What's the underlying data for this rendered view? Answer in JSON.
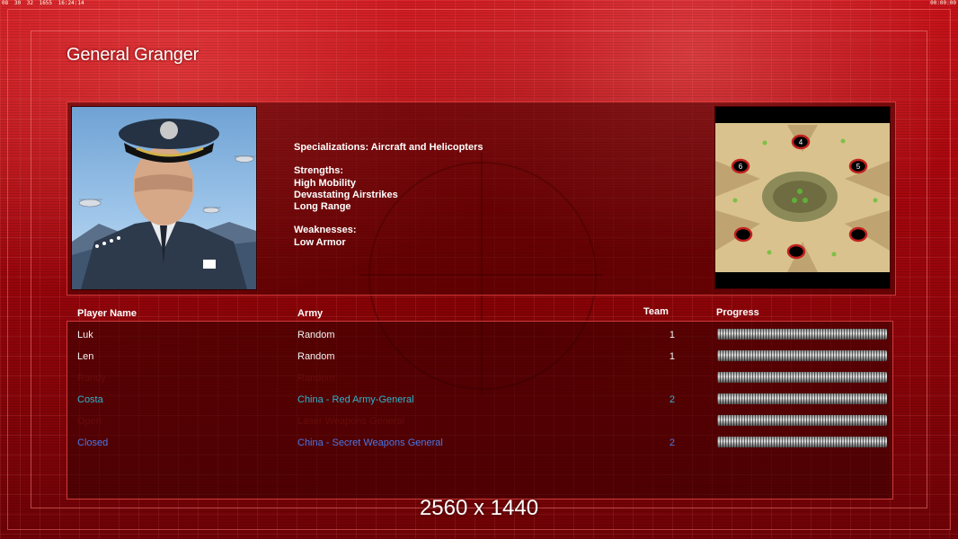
{
  "status_bar": {
    "left": [
      "08",
      "30",
      "32",
      "1655",
      "16:24:14"
    ],
    "right": "00:00:00"
  },
  "title": "General Granger",
  "general_info": {
    "specialization": "Specializations: Aircraft and Helicopters",
    "strengths_heading": "Strengths:",
    "strengths": [
      "High Mobility",
      "Devastating Airstrikes",
      "Long Range"
    ],
    "weaknesses_heading": "Weaknesses:",
    "weaknesses": [
      "Low Armor"
    ]
  },
  "map": {
    "start_positions": [
      "4",
      "6",
      "5",
      "",
      "",
      ""
    ]
  },
  "table": {
    "headers": {
      "player": "Player Name",
      "army": "Army",
      "team": "Team",
      "progress": "Progress"
    },
    "rows": [
      {
        "player": "Luk",
        "army": "Random",
        "team": "1",
        "style": "white"
      },
      {
        "player": "Len",
        "army": "Random",
        "team": "1",
        "style": "white"
      },
      {
        "player": "Randy",
        "army": "Random",
        "team": "",
        "style": "faint"
      },
      {
        "player": "Costa",
        "army": "China - Red Army-General",
        "team": "2",
        "style": "cyan"
      },
      {
        "player": "Open",
        "army": "Laser Weapons General",
        "team": "",
        "style": "faint"
      },
      {
        "player": "Closed",
        "army": "China - Secret Weapons General",
        "team": "2",
        "style": "blue"
      }
    ]
  },
  "resolution_caption": "2560 x 1440",
  "colors": {
    "background_red": "#b00a10",
    "panel_border": "#ff5050",
    "cyan_player": "#32b4cc",
    "blue_player": "#4a78e8"
  }
}
